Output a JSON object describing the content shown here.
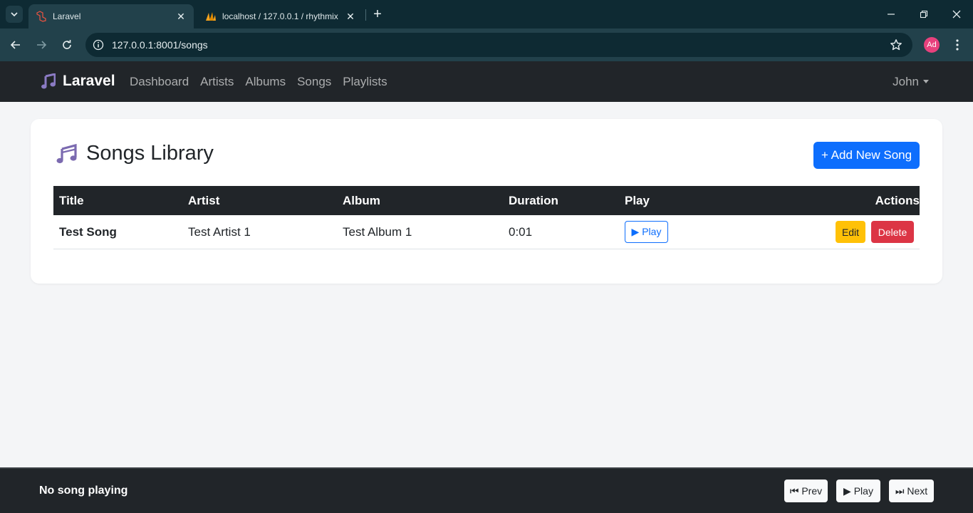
{
  "browser": {
    "tabs": [
      {
        "title": "Laravel",
        "active": true
      },
      {
        "title": "localhost / 127.0.0.1 / rhythmix",
        "active": false
      }
    ],
    "url": "127.0.0.1:8001/songs",
    "profile_initials": "Ad"
  },
  "navbar": {
    "brand": "Laravel",
    "links": [
      "Dashboard",
      "Artists",
      "Albums",
      "Songs",
      "Playlists"
    ],
    "user": "John"
  },
  "page": {
    "title": "Songs Library",
    "add_button": "+ Add New Song",
    "columns": [
      "Title",
      "Artist",
      "Album",
      "Duration",
      "Play",
      "Actions"
    ],
    "rows": [
      {
        "title": "Test Song",
        "artist": "Test Artist 1",
        "album": "Test Album 1",
        "duration": "0:01",
        "play": "▶ Play",
        "edit": "Edit",
        "delete": "Delete"
      }
    ]
  },
  "player": {
    "status": "No song playing",
    "prev": "⏮ Prev",
    "play": "▶ Play",
    "next": "⏭ Next"
  },
  "colors": {
    "primary": "#0d6efd",
    "warning": "#ffc107",
    "danger": "#dc3545",
    "dark": "#212529",
    "brand_icon": "#7b6ab0"
  }
}
